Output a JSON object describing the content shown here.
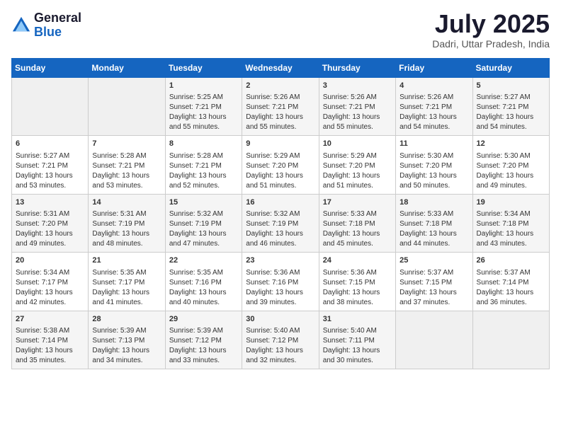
{
  "header": {
    "logo_general": "General",
    "logo_blue": "Blue",
    "month_year": "July 2025",
    "location": "Dadri, Uttar Pradesh, India"
  },
  "days_of_week": [
    "Sunday",
    "Monday",
    "Tuesday",
    "Wednesday",
    "Thursday",
    "Friday",
    "Saturday"
  ],
  "weeks": [
    [
      {
        "day": "",
        "info": ""
      },
      {
        "day": "",
        "info": ""
      },
      {
        "day": "1",
        "info": "Sunrise: 5:25 AM\nSunset: 7:21 PM\nDaylight: 13 hours and 55 minutes."
      },
      {
        "day": "2",
        "info": "Sunrise: 5:26 AM\nSunset: 7:21 PM\nDaylight: 13 hours and 55 minutes."
      },
      {
        "day": "3",
        "info": "Sunrise: 5:26 AM\nSunset: 7:21 PM\nDaylight: 13 hours and 55 minutes."
      },
      {
        "day": "4",
        "info": "Sunrise: 5:26 AM\nSunset: 7:21 PM\nDaylight: 13 hours and 54 minutes."
      },
      {
        "day": "5",
        "info": "Sunrise: 5:27 AM\nSunset: 7:21 PM\nDaylight: 13 hours and 54 minutes."
      }
    ],
    [
      {
        "day": "6",
        "info": "Sunrise: 5:27 AM\nSunset: 7:21 PM\nDaylight: 13 hours and 53 minutes."
      },
      {
        "day": "7",
        "info": "Sunrise: 5:28 AM\nSunset: 7:21 PM\nDaylight: 13 hours and 53 minutes."
      },
      {
        "day": "8",
        "info": "Sunrise: 5:28 AM\nSunset: 7:21 PM\nDaylight: 13 hours and 52 minutes."
      },
      {
        "day": "9",
        "info": "Sunrise: 5:29 AM\nSunset: 7:20 PM\nDaylight: 13 hours and 51 minutes."
      },
      {
        "day": "10",
        "info": "Sunrise: 5:29 AM\nSunset: 7:20 PM\nDaylight: 13 hours and 51 minutes."
      },
      {
        "day": "11",
        "info": "Sunrise: 5:30 AM\nSunset: 7:20 PM\nDaylight: 13 hours and 50 minutes."
      },
      {
        "day": "12",
        "info": "Sunrise: 5:30 AM\nSunset: 7:20 PM\nDaylight: 13 hours and 49 minutes."
      }
    ],
    [
      {
        "day": "13",
        "info": "Sunrise: 5:31 AM\nSunset: 7:20 PM\nDaylight: 13 hours and 49 minutes."
      },
      {
        "day": "14",
        "info": "Sunrise: 5:31 AM\nSunset: 7:19 PM\nDaylight: 13 hours and 48 minutes."
      },
      {
        "day": "15",
        "info": "Sunrise: 5:32 AM\nSunset: 7:19 PM\nDaylight: 13 hours and 47 minutes."
      },
      {
        "day": "16",
        "info": "Sunrise: 5:32 AM\nSunset: 7:19 PM\nDaylight: 13 hours and 46 minutes."
      },
      {
        "day": "17",
        "info": "Sunrise: 5:33 AM\nSunset: 7:18 PM\nDaylight: 13 hours and 45 minutes."
      },
      {
        "day": "18",
        "info": "Sunrise: 5:33 AM\nSunset: 7:18 PM\nDaylight: 13 hours and 44 minutes."
      },
      {
        "day": "19",
        "info": "Sunrise: 5:34 AM\nSunset: 7:18 PM\nDaylight: 13 hours and 43 minutes."
      }
    ],
    [
      {
        "day": "20",
        "info": "Sunrise: 5:34 AM\nSunset: 7:17 PM\nDaylight: 13 hours and 42 minutes."
      },
      {
        "day": "21",
        "info": "Sunrise: 5:35 AM\nSunset: 7:17 PM\nDaylight: 13 hours and 41 minutes."
      },
      {
        "day": "22",
        "info": "Sunrise: 5:35 AM\nSunset: 7:16 PM\nDaylight: 13 hours and 40 minutes."
      },
      {
        "day": "23",
        "info": "Sunrise: 5:36 AM\nSunset: 7:16 PM\nDaylight: 13 hours and 39 minutes."
      },
      {
        "day": "24",
        "info": "Sunrise: 5:36 AM\nSunset: 7:15 PM\nDaylight: 13 hours and 38 minutes."
      },
      {
        "day": "25",
        "info": "Sunrise: 5:37 AM\nSunset: 7:15 PM\nDaylight: 13 hours and 37 minutes."
      },
      {
        "day": "26",
        "info": "Sunrise: 5:37 AM\nSunset: 7:14 PM\nDaylight: 13 hours and 36 minutes."
      }
    ],
    [
      {
        "day": "27",
        "info": "Sunrise: 5:38 AM\nSunset: 7:14 PM\nDaylight: 13 hours and 35 minutes."
      },
      {
        "day": "28",
        "info": "Sunrise: 5:39 AM\nSunset: 7:13 PM\nDaylight: 13 hours and 34 minutes."
      },
      {
        "day": "29",
        "info": "Sunrise: 5:39 AM\nSunset: 7:12 PM\nDaylight: 13 hours and 33 minutes."
      },
      {
        "day": "30",
        "info": "Sunrise: 5:40 AM\nSunset: 7:12 PM\nDaylight: 13 hours and 32 minutes."
      },
      {
        "day": "31",
        "info": "Sunrise: 5:40 AM\nSunset: 7:11 PM\nDaylight: 13 hours and 30 minutes."
      },
      {
        "day": "",
        "info": ""
      },
      {
        "day": "",
        "info": ""
      }
    ]
  ]
}
